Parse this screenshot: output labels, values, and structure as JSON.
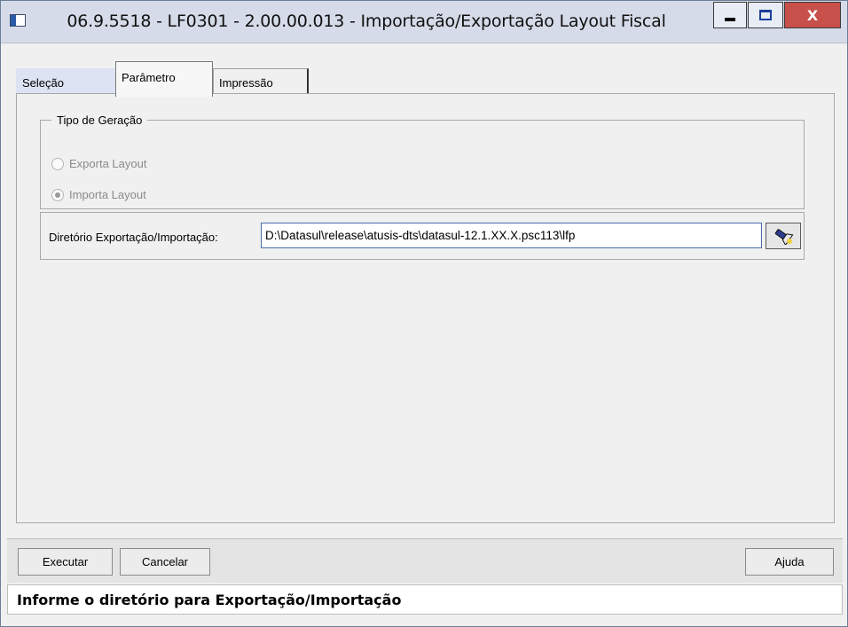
{
  "window": {
    "title": "06.9.5518 - LF0301 - 2.00.00.013 - Importação/Exportação Layout Fiscal",
    "close_label": "X"
  },
  "tabs": [
    {
      "label": "Seleção"
    },
    {
      "label": "Parâmetro"
    },
    {
      "label": "Impressão"
    }
  ],
  "parametro": {
    "group_title": "Tipo de Geração",
    "options": [
      {
        "label": "Exporta Layout",
        "checked": false
      },
      {
        "label": "Importa Layout",
        "checked": true
      }
    ],
    "dir_label": "Diretório Exportação/Importação:",
    "dir_value": "D:\\Datasul\\release\\atusis-dts\\datasul-12.1.XX.X.psc113\\lfp"
  },
  "buttons": {
    "execute": "Executar",
    "cancel": "Cancelar",
    "help": "Ajuda"
  },
  "status": {
    "message": "Informe o diretório para Exportação/Importação"
  },
  "colors": {
    "title_bar": "#d6dbe9",
    "close_button": "#c7504a",
    "input_border": "#4a6ea9"
  },
  "icons": {
    "browse": "flashlight-icon",
    "app": "window-app-icon"
  }
}
